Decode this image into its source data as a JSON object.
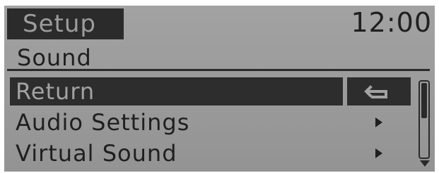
{
  "header": {
    "title": "Setup",
    "clock": "12:00"
  },
  "subheader": {
    "title": "Sound"
  },
  "menu": {
    "items": [
      {
        "label": "Return",
        "selected": true,
        "icon": "return-arrow-icon"
      },
      {
        "label": "Audio Settings",
        "selected": false,
        "icon": "chevron-right-icon"
      },
      {
        "label": "Virtual Sound",
        "selected": false,
        "icon": "chevron-right-icon"
      }
    ]
  },
  "scrollbar": {
    "position": 0
  },
  "colors": {
    "screen_background": "#9b9b9b",
    "highlight": "#2d2d2d",
    "text": "#1f1f1f",
    "highlight_text": "#a3a3a3"
  }
}
